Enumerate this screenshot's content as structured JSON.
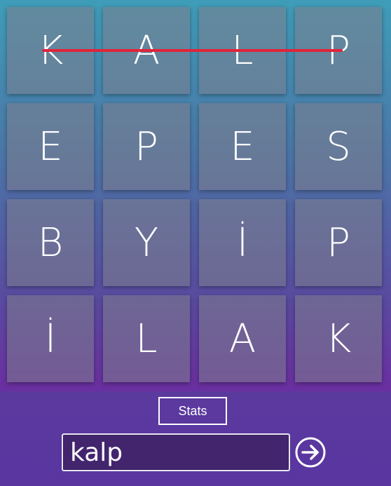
{
  "board": {
    "rows": [
      [
        "K",
        "A",
        "L",
        "P"
      ],
      [
        "E",
        "P",
        "E",
        "S"
      ],
      [
        "B",
        "Y",
        "İ",
        "P"
      ],
      [
        "İ",
        "L",
        "A",
        "K"
      ]
    ],
    "selected_path": [
      [
        0,
        0
      ],
      [
        0,
        1
      ],
      [
        0,
        2
      ],
      [
        0,
        3
      ]
    ],
    "path_color": "#e0243a"
  },
  "controls": {
    "stats_label": "Stats",
    "word_value": "kalp",
    "submit_icon": "arrow-right-circle-icon"
  }
}
